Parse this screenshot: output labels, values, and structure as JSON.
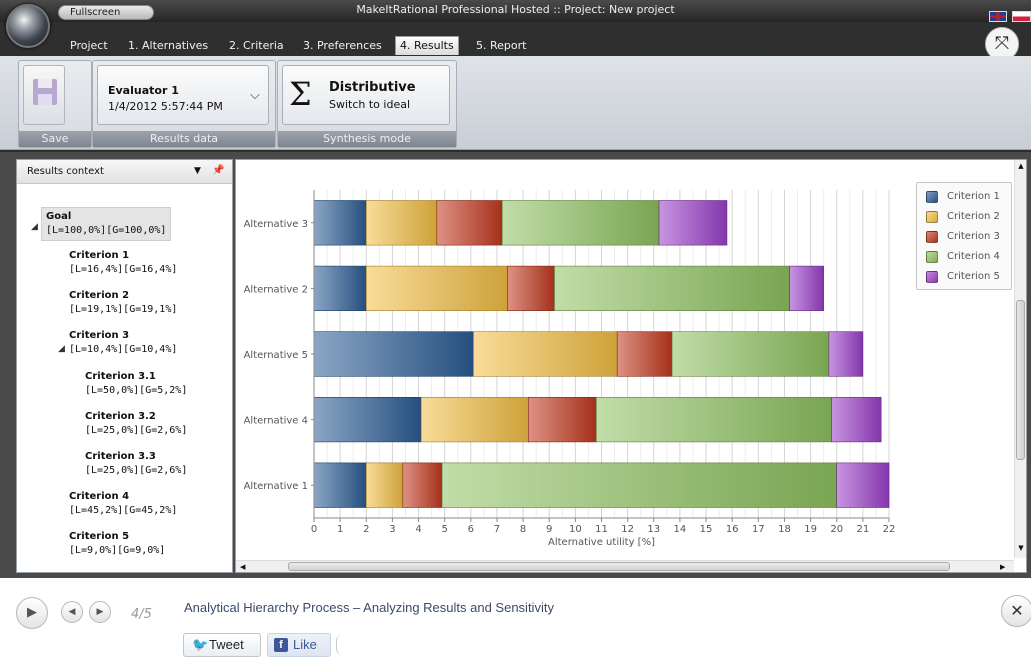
{
  "window": {
    "title": "MakeItRational Professional Hosted :: Project: New project",
    "fullscreen_label": "Fullscreen"
  },
  "menu": {
    "tabs": [
      {
        "label": "Project"
      },
      {
        "label": "1. Alternatives"
      },
      {
        "label": "2. Criteria"
      },
      {
        "label": "3. Preferences"
      },
      {
        "label": "4. Results",
        "active": true
      },
      {
        "label": "5. Report"
      }
    ]
  },
  "ribbon": {
    "save_group_label": "Save",
    "results_group_label": "Results data",
    "evaluator": {
      "name": "Evaluator 1",
      "date": "1/4/2012 5:57:44 PM"
    },
    "mode_group_label": "Synthesis mode",
    "mode": {
      "title": "Distributive",
      "subtitle": "Switch to ideal",
      "icon": "Σ"
    }
  },
  "context": {
    "title": "Results context",
    "tree": [
      {
        "name": "Goal",
        "vals": "[L=100,0%][G=100,0%]"
      },
      {
        "name": "Criterion 1",
        "vals": "[L=16,4%][G=16,4%]"
      },
      {
        "name": "Criterion 2",
        "vals": "[L=19,1%][G=19,1%]"
      },
      {
        "name": "Criterion 3",
        "vals": "[L=10,4%][G=10,4%]"
      },
      {
        "name": "Criterion 3.1",
        "vals": "[L=50,0%][G=5,2%]"
      },
      {
        "name": "Criterion 3.2",
        "vals": "[L=25,0%][G=2,6%]"
      },
      {
        "name": "Criterion 3.3",
        "vals": "[L=25,0%][G=2,6%]"
      },
      {
        "name": "Criterion 4",
        "vals": "[L=45,2%][G=45,2%]"
      },
      {
        "name": "Criterion 5",
        "vals": "[L=9,0%][G=9,0%]"
      }
    ]
  },
  "colors": {
    "criterion_1": "#2c5d95",
    "criterion_2": "#f2bf44",
    "criterion_3": "#c2391f",
    "criterion_4": "#8ec260",
    "criterion_5": "#9b3fc9"
  },
  "chart_data": {
    "type": "bar",
    "orientation": "horizontal",
    "stacked": true,
    "categories": [
      "Alternative 3",
      "Alternative 2",
      "Alternative 5",
      "Alternative 4",
      "Alternative 1"
    ],
    "series": [
      {
        "name": "Criterion 1",
        "values": [
          2.0,
          2.0,
          6.1,
          4.1,
          2.0
        ]
      },
      {
        "name": "Criterion 2",
        "values": [
          2.7,
          5.4,
          5.5,
          4.1,
          1.4
        ]
      },
      {
        "name": "Criterion 3",
        "values": [
          2.5,
          1.8,
          2.1,
          2.6,
          1.5
        ]
      },
      {
        "name": "Criterion 4",
        "values": [
          6.0,
          9.0,
          6.0,
          9.0,
          15.1
        ]
      },
      {
        "name": "Criterion 5",
        "values": [
          2.6,
          1.3,
          1.3,
          1.9,
          2.0
        ]
      }
    ],
    "xlabel": "Alternative utility [%]",
    "xlim": [
      0,
      22
    ],
    "xticks": [
      0,
      1,
      2,
      3,
      4,
      5,
      6,
      7,
      8,
      9,
      10,
      11,
      12,
      13,
      14,
      15,
      16,
      17,
      18,
      19,
      20,
      21,
      22
    ],
    "grid": true,
    "legend": "top-right"
  },
  "player": {
    "counter": "4/5",
    "title": "Analytical Hierarchy Process – Analyzing Results and Sensitivity",
    "tweet_label": "Tweet",
    "like_label": "Like"
  }
}
